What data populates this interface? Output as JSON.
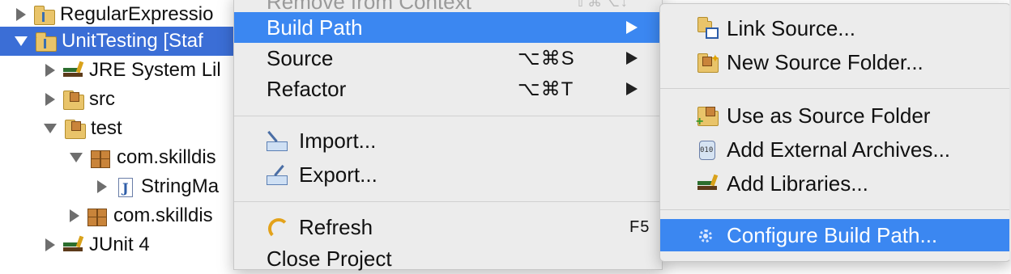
{
  "tree": {
    "items": [
      {
        "label": "RegularExpressio",
        "expanded": false,
        "selected": false,
        "icon": "java-project-icon"
      },
      {
        "label": "UnitTesting [Staf",
        "expanded": true,
        "selected": true,
        "icon": "java-project-icon"
      },
      {
        "label": "JRE System Lil",
        "expanded": false,
        "selected": false,
        "icon": "library-icon"
      },
      {
        "label": "src",
        "expanded": false,
        "selected": false,
        "icon": "source-folder-icon"
      },
      {
        "label": "test",
        "expanded": true,
        "selected": false,
        "icon": "source-folder-icon"
      },
      {
        "label": "com.skilldis",
        "expanded": true,
        "selected": false,
        "icon": "package-icon"
      },
      {
        "label": "StringMa",
        "expanded": false,
        "selected": false,
        "icon": "java-file-icon"
      },
      {
        "label": "com.skilldis",
        "expanded": false,
        "selected": false,
        "icon": "package-icon"
      },
      {
        "label": "JUnit 4",
        "expanded": false,
        "selected": false,
        "icon": "library-icon"
      }
    ]
  },
  "menu": {
    "partial_top": "Remove from Context",
    "partial_top_shortcut": "⇧⌘⌥↓",
    "build_path": "Build Path",
    "source": "Source",
    "source_shortcut": "⌥⌘S",
    "refactor": "Refactor",
    "refactor_shortcut": "⌥⌘T",
    "import": "Import...",
    "export": "Export...",
    "refresh": "Refresh",
    "refresh_shortcut": "F5",
    "close_project": "Close Project"
  },
  "submenu": {
    "link_source": "Link Source...",
    "new_source_folder": "New Source Folder...",
    "use_as_source_folder": "Use as Source Folder",
    "add_external_archives": "Add External Archives...",
    "add_libraries": "Add Libraries...",
    "configure_build_path": "Configure Build Path..."
  },
  "colors": {
    "selection": "#3b6ed6",
    "menu_highlight": "#3b87f1",
    "menu_background": "#ececec"
  }
}
